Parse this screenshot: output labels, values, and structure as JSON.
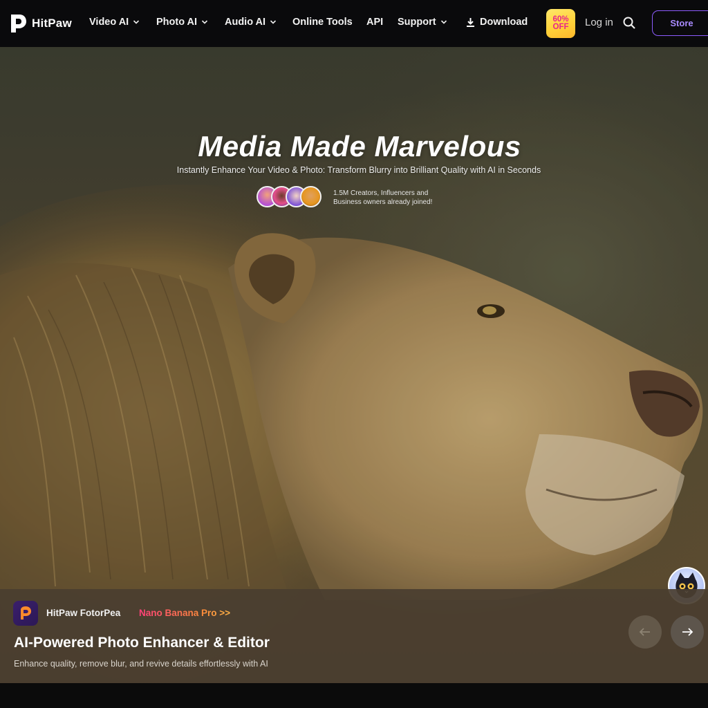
{
  "nav": {
    "logo_text": "HitPaw",
    "items": [
      {
        "label": "Video AI",
        "has_menu": true
      },
      {
        "label": "Photo AI",
        "has_menu": true
      },
      {
        "label": "Audio AI",
        "has_menu": true
      },
      {
        "label": "Online Tools",
        "has_menu": false
      },
      {
        "label": "API",
        "has_menu": false
      },
      {
        "label": "Support",
        "has_menu": true
      }
    ],
    "download_label": "Download",
    "promo_line1": "60%",
    "promo_line2": "OFF",
    "login_label": "Log in",
    "store_label": "Store",
    "accent_color": "#8d5cff"
  },
  "hero": {
    "title": "Media Made Marvelous",
    "subtitle": "Instantly Enhance Your Video & Photo: Transform Blurry into Brilliant Quality with AI in Seconds",
    "joined_line1": "1.5M Creators, Influencers and",
    "joined_line2": "Business owners already joined!",
    "avatar_count": 4
  },
  "card": {
    "app_name": "HitPaw FotorPea",
    "badge_link": "Nano Banana Pro >>",
    "title": "AI-Powered Photo Enhancer & Editor",
    "description": "Enhance quality, remove blur, and revive details effortlessly with AI",
    "prev_icon": "arrow-left-icon",
    "next_icon": "arrow-right-icon"
  }
}
